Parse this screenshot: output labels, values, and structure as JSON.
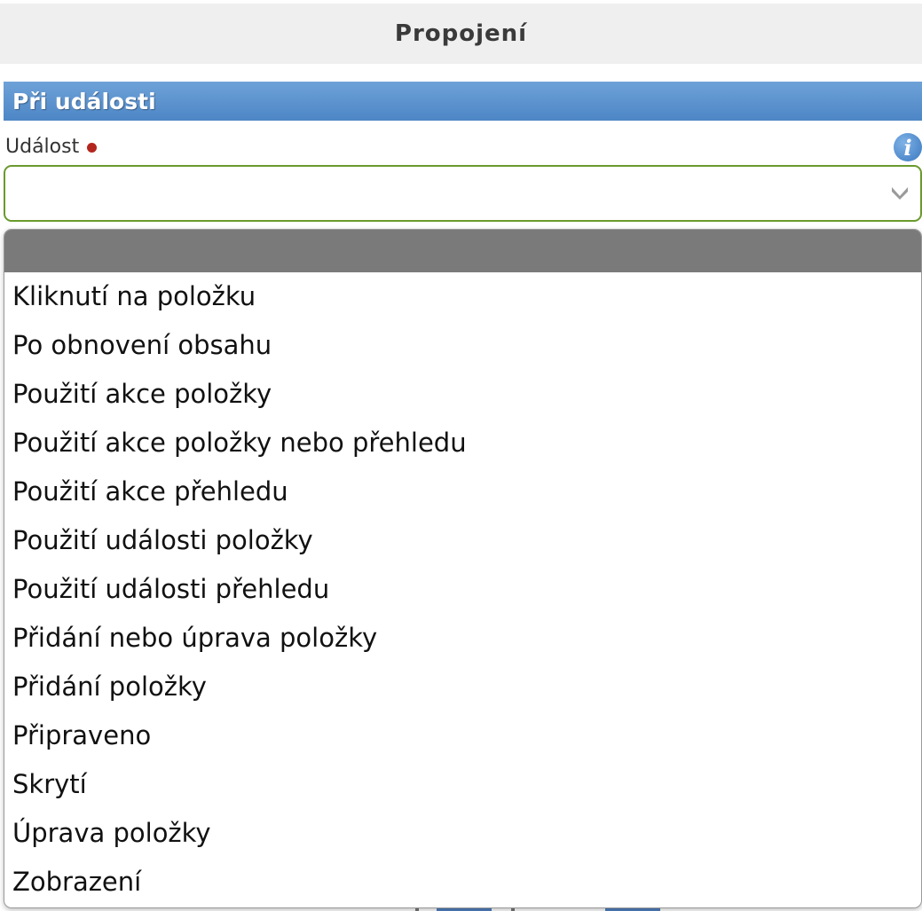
{
  "window": {
    "title": "Propojení"
  },
  "section": {
    "title": "Při události"
  },
  "field": {
    "label": "Událost",
    "value": "",
    "required": true,
    "info_icon": "info-icon",
    "accent_color": "#6a9a2e"
  },
  "dropdown": {
    "selected_label": "",
    "options": [
      {
        "label": "Kliknutí na položku"
      },
      {
        "label": "Po obnovení obsahu"
      },
      {
        "label": "Použití akce položky"
      },
      {
        "label": "Použití akce položky nebo přehledu"
      },
      {
        "label": "Použití akce přehledu"
      },
      {
        "label": "Použití události položky"
      },
      {
        "label": "Použití události přehledu"
      },
      {
        "label": "Přidání nebo úprava položky"
      },
      {
        "label": "Přidání položky"
      },
      {
        "label": "Připraveno"
      },
      {
        "label": "Skrytí"
      },
      {
        "label": "Úprava položky"
      },
      {
        "label": "Zobrazení"
      }
    ]
  },
  "colors": {
    "section_header": "#4d86c6",
    "required_dot": "#b3261e",
    "highlight": "#7a7a7a"
  }
}
